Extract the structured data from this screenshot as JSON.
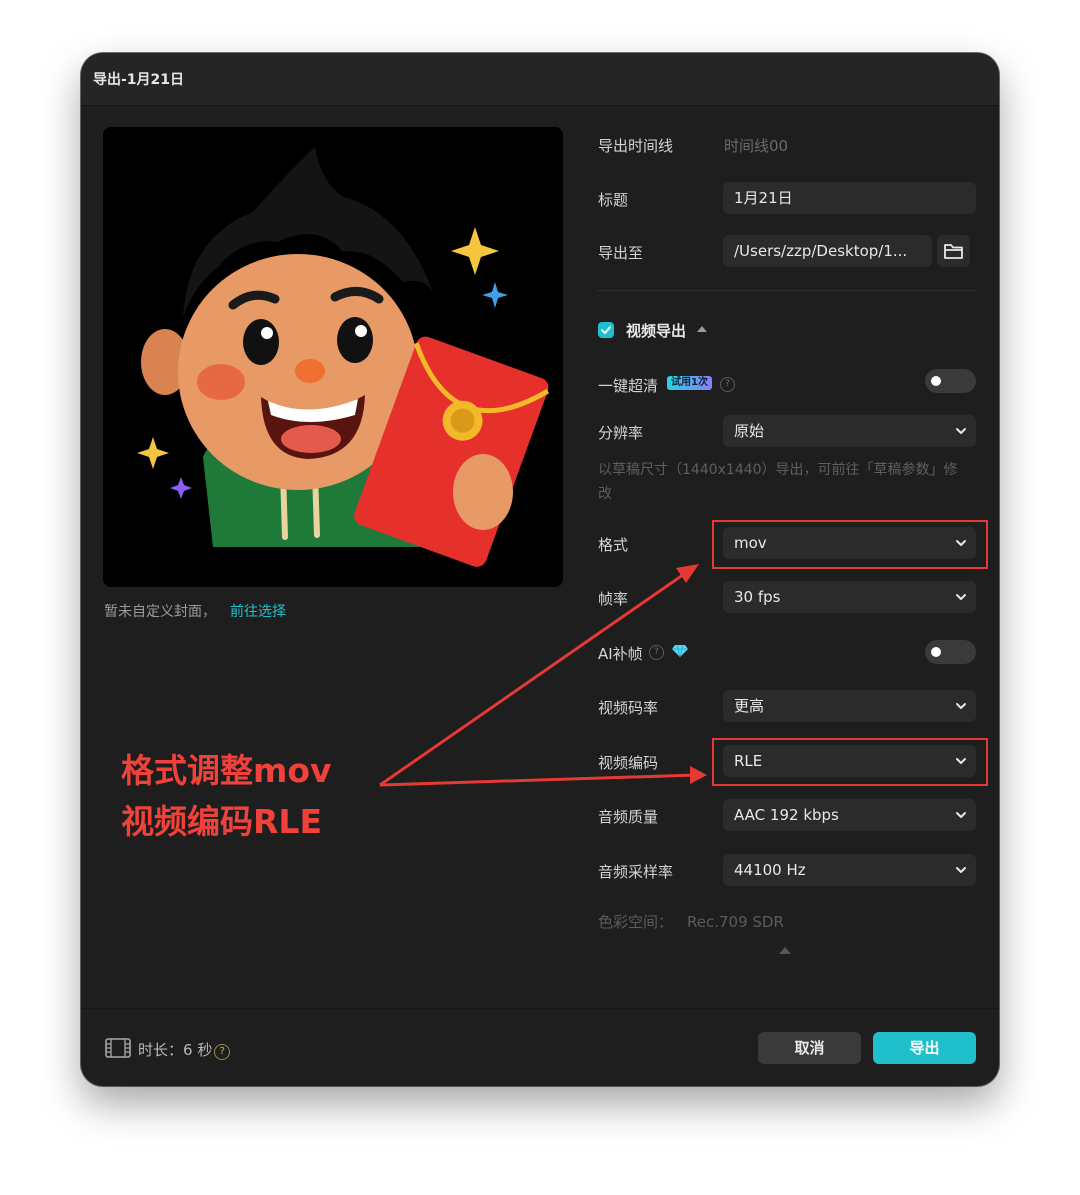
{
  "window": {
    "title": "导出-1月21日"
  },
  "preview": {
    "cover_note": "暂未自定义封面，",
    "cover_link": "前往选择"
  },
  "settings": {
    "timeline_label": "导出时间线",
    "timeline_value": "时间线00",
    "title_label": "标题",
    "title_value": "1月21日",
    "export_to_label": "导出至",
    "export_to_value": "/Users/zzp/Desktop/1...",
    "video_export_label": "视频导出",
    "enhance_label": "一键超清",
    "enhance_badge": "试用1次",
    "resolution_label": "分辨率",
    "resolution_value": "原始",
    "resolution_hint": "以草稿尺寸（1440x1440）导出，可前往「草稿参数」修改",
    "format_label": "格式",
    "format_value": "mov",
    "framerate_label": "帧率",
    "framerate_value": "30 fps",
    "ai_frame_label": "AI补帧",
    "bitrate_label": "视频码率",
    "bitrate_value": "更高",
    "codec_label": "视频编码",
    "codec_value": "RLE",
    "audio_quality_label": "音频质量",
    "audio_quality_value": "AAC 192 kbps",
    "sample_rate_label": "音频采样率",
    "sample_rate_value": "44100 Hz",
    "color_space_label": "色彩空间：",
    "color_space_value": "Rec.709 SDR"
  },
  "footer": {
    "duration_label": "时长：",
    "duration_value": "6 秒",
    "cancel": "取消",
    "export": "导出"
  },
  "annotation": {
    "line1": "格式调整mov",
    "line2": "视频编码RLE"
  },
  "colors": {
    "accent": "#1fbfcb",
    "annotation": "#e53935",
    "dialog_bg": "#1e1e1e"
  },
  "icons": [
    "folder-icon",
    "check-icon",
    "chevron-down-icon",
    "help-icon",
    "diamond-icon",
    "film-icon"
  ]
}
